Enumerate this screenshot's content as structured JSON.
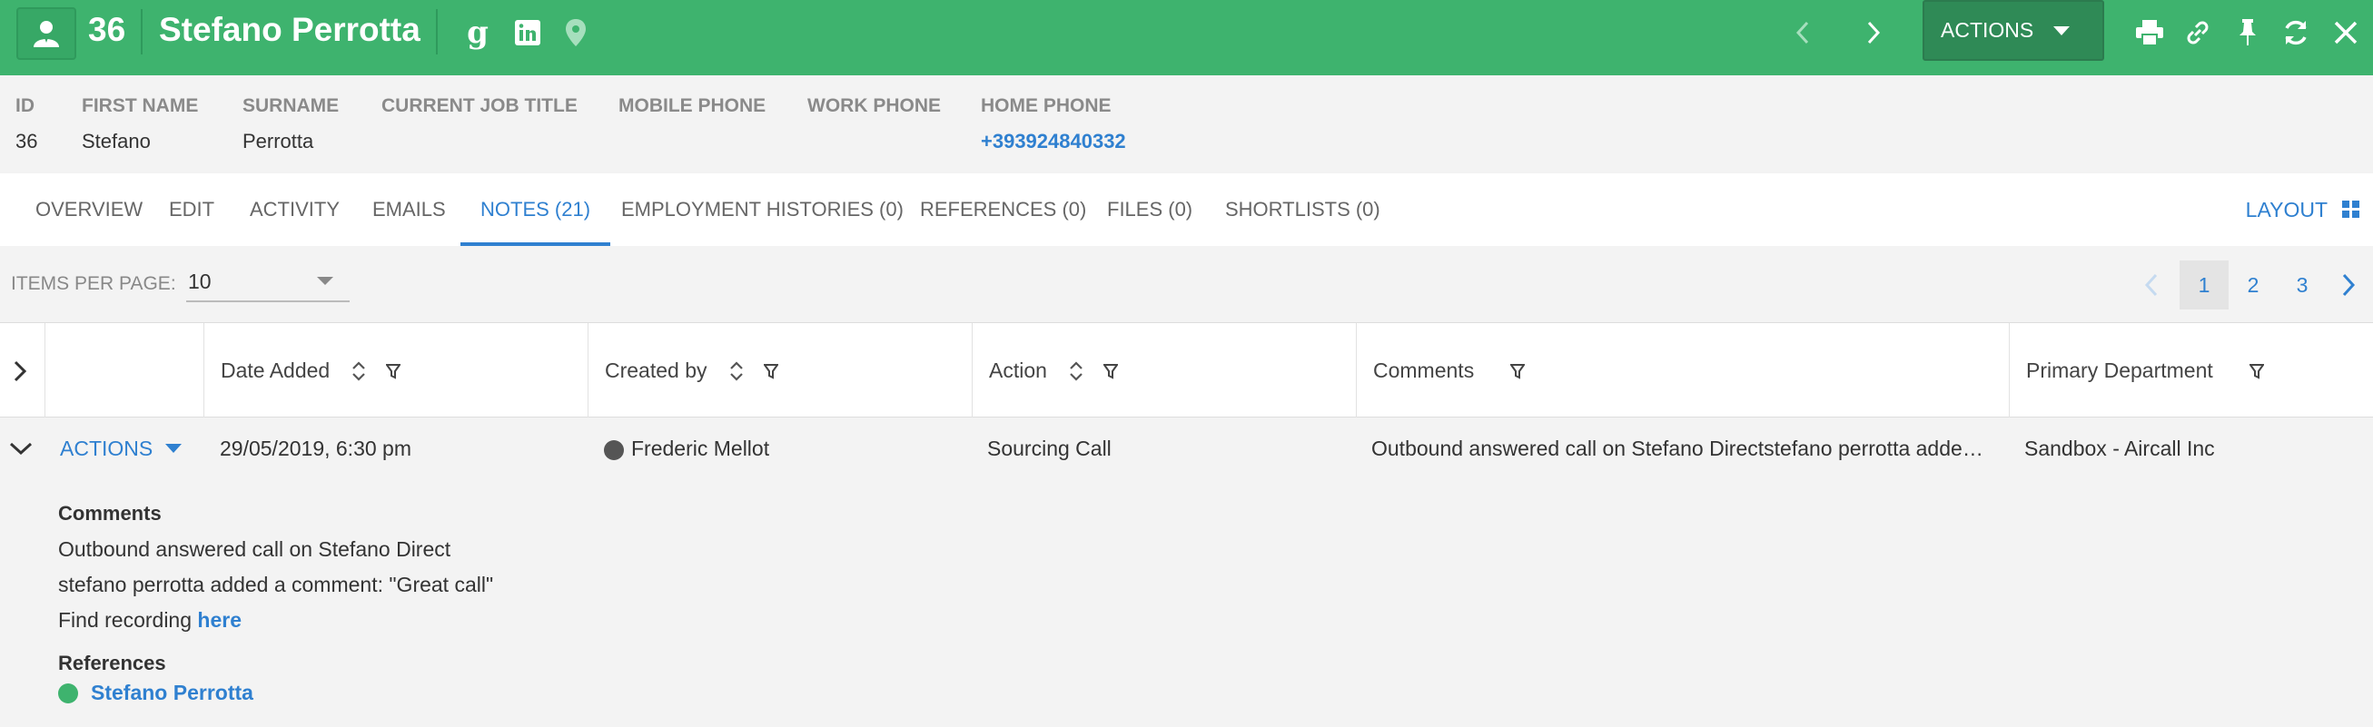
{
  "colors": {
    "brand": "#3eb36e",
    "link": "#2f80d0"
  },
  "header": {
    "id": "36",
    "name": "Stefano Perrotta",
    "actions_label": "ACTIONS",
    "icons": [
      "candidate-icon",
      "google-icon",
      "linkedin-icon",
      "location-pin-icon",
      "prev-chevron-icon",
      "next-chevron-icon",
      "print-icon",
      "link-icon",
      "pin-icon",
      "refresh-icon",
      "close-icon"
    ]
  },
  "info": {
    "fields": [
      {
        "label": "ID",
        "value": "36"
      },
      {
        "label": "FIRST NAME",
        "value": "Stefano"
      },
      {
        "label": "SURNAME",
        "value": "Perrotta"
      },
      {
        "label": "CURRENT JOB TITLE",
        "value": ""
      },
      {
        "label": "MOBILE PHONE",
        "value": ""
      },
      {
        "label": "WORK PHONE",
        "value": ""
      },
      {
        "label": "HOME PHONE",
        "value": "+393924840332"
      }
    ]
  },
  "tabs": [
    {
      "label": "OVERVIEW"
    },
    {
      "label": "EDIT"
    },
    {
      "label": "ACTIVITY"
    },
    {
      "label": "EMAILS"
    },
    {
      "label": "NOTES (21)"
    },
    {
      "label": "EMPLOYMENT HISTORIES (0)"
    },
    {
      "label": "REFERENCES (0)"
    },
    {
      "label": "FILES (0)"
    },
    {
      "label": "SHORTLISTS (0)"
    }
  ],
  "layout_label": "LAYOUT",
  "pager": {
    "items_per_page_label": "ITEMS PER PAGE:",
    "items_per_page_value": "10",
    "pages": [
      "1",
      "2",
      "3"
    ],
    "current_page": "1"
  },
  "table": {
    "columns": [
      "Date Added",
      "Created by",
      "Action",
      "Comments",
      "Primary Department"
    ],
    "rows": [
      {
        "actions_label": "ACTIONS",
        "date_added": "29/05/2019, 6:30 pm",
        "created_by": "Frederic Mellot",
        "action": "Sourcing Call",
        "comments": "Outbound answered call on Stefano Directstefano perrotta added a comment: \"Great call\"Find recording here",
        "primary_department": "Sandbox - Aircall Inc"
      }
    ]
  },
  "detail": {
    "comments_heading": "Comments",
    "line1": "Outbound answered call on Stefano Direct",
    "line2": "stefano perrotta added a comment: \"Great call\"",
    "line3_prefix": "Find recording ",
    "line3_link": "here",
    "references_heading": "References",
    "reference_name": "Stefano Perrotta"
  }
}
